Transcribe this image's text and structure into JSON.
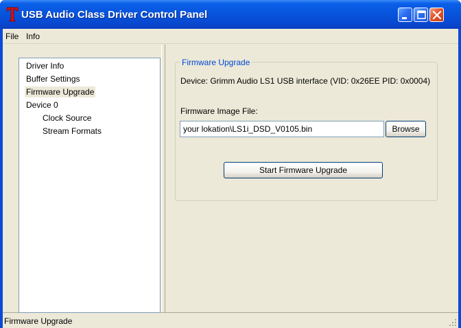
{
  "window": {
    "title": "USB Audio Class Driver Control Panel",
    "app_icon": "red-t-icon",
    "controls": [
      "minimize-icon",
      "maximize-icon",
      "close-icon"
    ]
  },
  "menu": {
    "items": [
      "File",
      "Info"
    ]
  },
  "tree": {
    "items": [
      {
        "label": "Driver Info",
        "level": 0,
        "selected": false
      },
      {
        "label": "Buffer Settings",
        "level": 0,
        "selected": false
      },
      {
        "label": "Firmware Upgrade",
        "level": 0,
        "selected": true
      },
      {
        "label": "Device 0",
        "level": 0,
        "selected": false
      },
      {
        "label": "Clock Source",
        "level": 1,
        "selected": false
      },
      {
        "label": "Stream Formats",
        "level": 1,
        "selected": false
      }
    ]
  },
  "firmware": {
    "group_title": "Firmware Upgrade",
    "device_text": "Device: Grimm Audio LS1 USB interface (VID: 0x26EE PID: 0x0004)",
    "file_label": "Firmware Image File:",
    "file_value": "your lokation\\LS1i_DSD_V0105.bin",
    "browse_label": "Browse",
    "start_label": "Start Firmware Upgrade"
  },
  "status": {
    "text": "Firmware Upgrade"
  },
  "colors": {
    "titlebar": "#0855dd",
    "group_title": "#0046d5",
    "app_icon": "#e01010"
  }
}
